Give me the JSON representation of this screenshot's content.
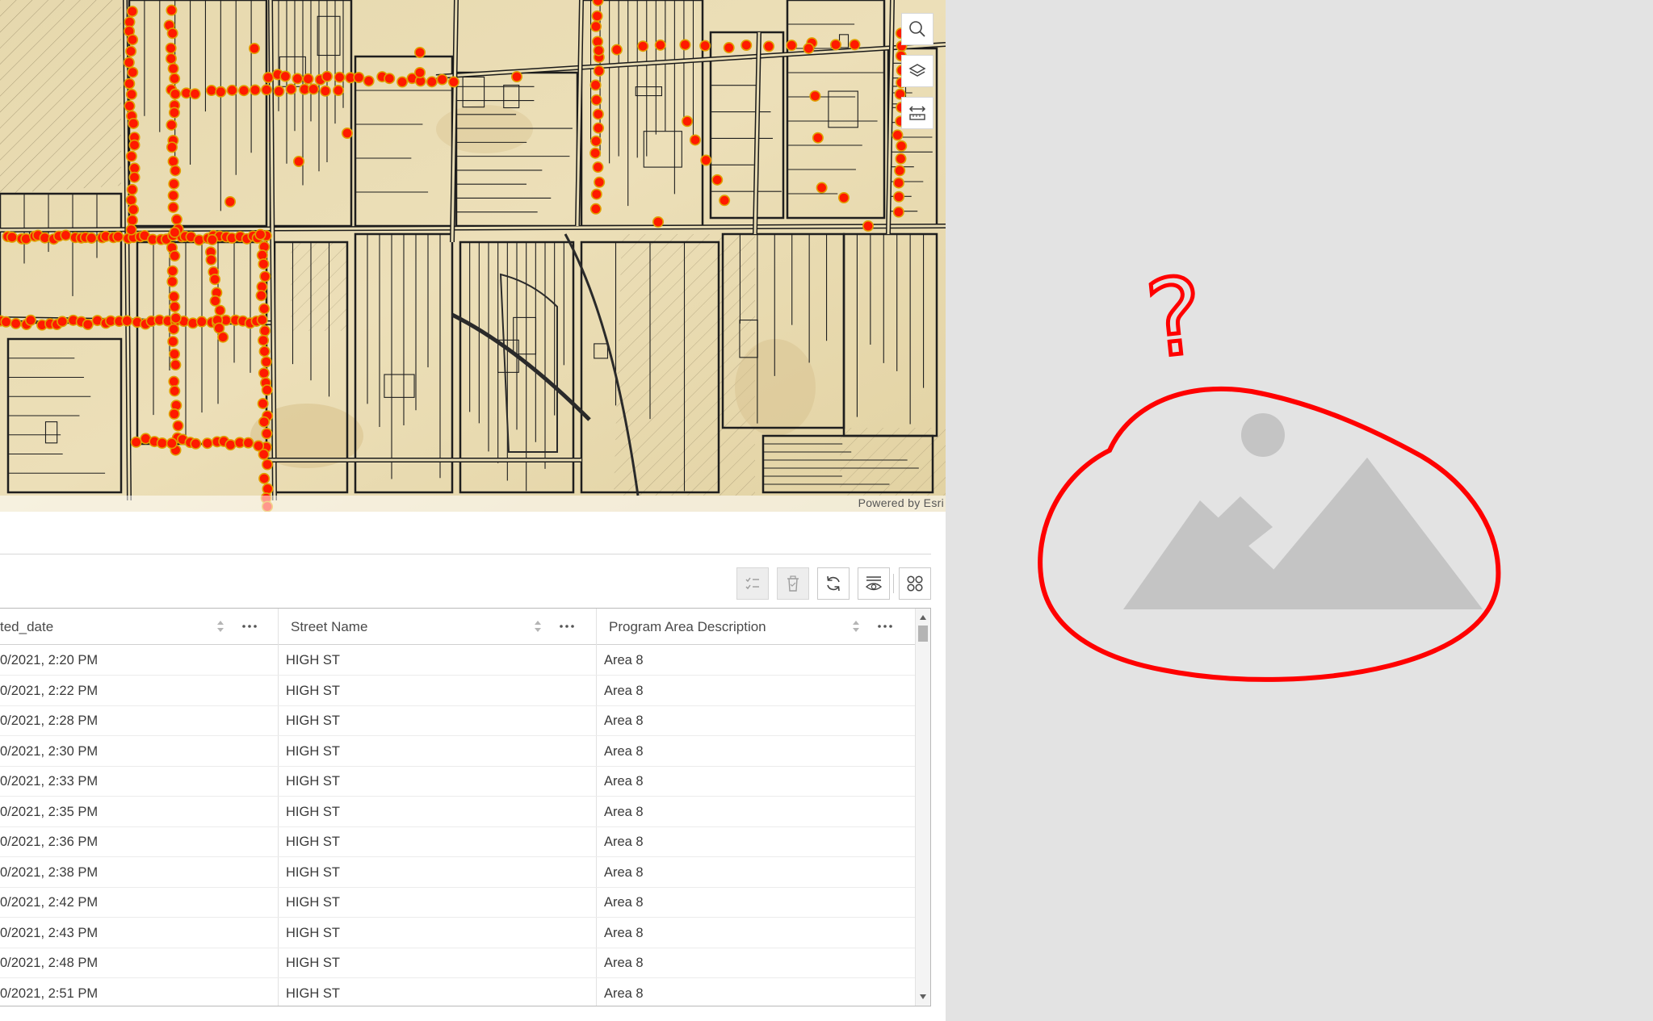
{
  "map": {
    "attribution": "Powered by Esri",
    "tools": [
      {
        "name": "search-tool",
        "icon": "search-icon"
      },
      {
        "name": "layer-list-tool",
        "icon": "layers-icon"
      },
      {
        "name": "measure-tool",
        "icon": "measure-icon"
      }
    ]
  },
  "toolbar": {
    "buttons": [
      {
        "name": "show-selected-button",
        "icon": "checklist-icon",
        "enabled": false
      },
      {
        "name": "delete-selection-button",
        "icon": "trash-icon",
        "enabled": false
      },
      {
        "name": "refresh-button",
        "icon": "refresh-icon",
        "enabled": true
      },
      {
        "name": "toggle-columns-button",
        "icon": "show-columns-icon",
        "enabled": true
      },
      {
        "name": "options-button",
        "icon": "grid-apps-icon",
        "enabled": true
      }
    ]
  },
  "table": {
    "columns": [
      {
        "label": "ted_date"
      },
      {
        "label": "Street Name"
      },
      {
        "label": "Program Area Description"
      }
    ],
    "rows": [
      [
        "0/2021, 2:20 PM",
        "HIGH ST",
        "Area 8"
      ],
      [
        "0/2021, 2:22 PM",
        "HIGH ST",
        "Area 8"
      ],
      [
        "0/2021, 2:28 PM",
        "HIGH ST",
        "Area 8"
      ],
      [
        "0/2021, 2:30 PM",
        "HIGH ST",
        "Area 8"
      ],
      [
        "0/2021, 2:33 PM",
        "HIGH ST",
        "Area 8"
      ],
      [
        "0/2021, 2:35 PM",
        "HIGH ST",
        "Area 8"
      ],
      [
        "0/2021, 2:36 PM",
        "HIGH ST",
        "Area 8"
      ],
      [
        "0/2021, 2:38 PM",
        "HIGH ST",
        "Area 8"
      ],
      [
        "0/2021, 2:42 PM",
        "HIGH ST",
        "Area 8"
      ],
      [
        "0/2021, 2:43 PM",
        "HIGH ST",
        "Area 8"
      ],
      [
        "0/2021, 2:48 PM",
        "HIGH ST",
        "Area 8"
      ],
      [
        "0/2021, 2:51 PM",
        "HIGH ST",
        "Area 8"
      ]
    ]
  },
  "annotation": {
    "mark": "?",
    "icon": "image-placeholder-icon",
    "color": "#ff0000"
  },
  "colors": {
    "map_base": "#e8dcb4",
    "point_fill": "#ff1a00",
    "point_stroke": "#e0a000",
    "parcel_line": "#1e1e1e"
  }
}
